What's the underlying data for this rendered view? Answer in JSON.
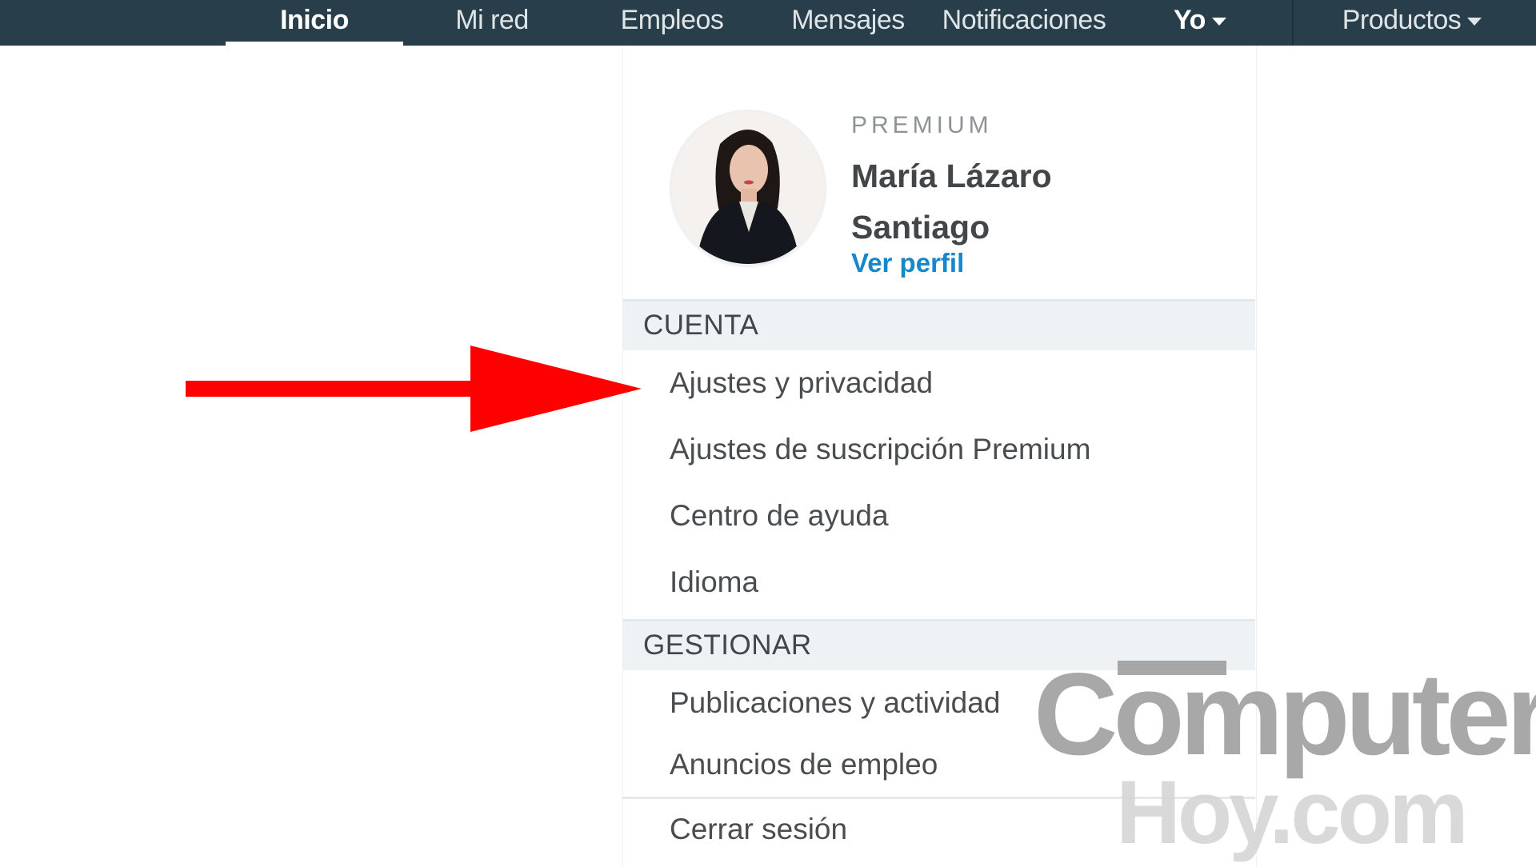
{
  "nav": {
    "items": [
      {
        "label": "Inicio",
        "active": true
      },
      {
        "label": "Mi red"
      },
      {
        "label": "Empleos"
      },
      {
        "label": "Mensajes"
      },
      {
        "label": "Notificaciones"
      },
      {
        "label": "Yo"
      },
      {
        "label": "Productos"
      }
    ],
    "bar_color": "#283e4a"
  },
  "profile": {
    "tier": "PREMIUM",
    "name_line1": "María Lázaro",
    "name_line2": "Santiago",
    "view_profile_link": "Ver perfil"
  },
  "sections": {
    "account": {
      "title": "CUENTA",
      "items": [
        "Ajustes y privacidad",
        "Ajustes de suscripción Premium",
        "Centro de ayuda",
        "Idioma"
      ]
    },
    "manage": {
      "title": "GESTIONAR",
      "items": [
        "Publicaciones y actividad",
        "Anuncios de empleo"
      ]
    }
  },
  "sign_out": "Cerrar sesión",
  "watermark": {
    "main": "Computer",
    "sub": "Hoy.com"
  },
  "colors": {
    "link": "#1588c9",
    "annotation_arrow": "#ff0000"
  }
}
